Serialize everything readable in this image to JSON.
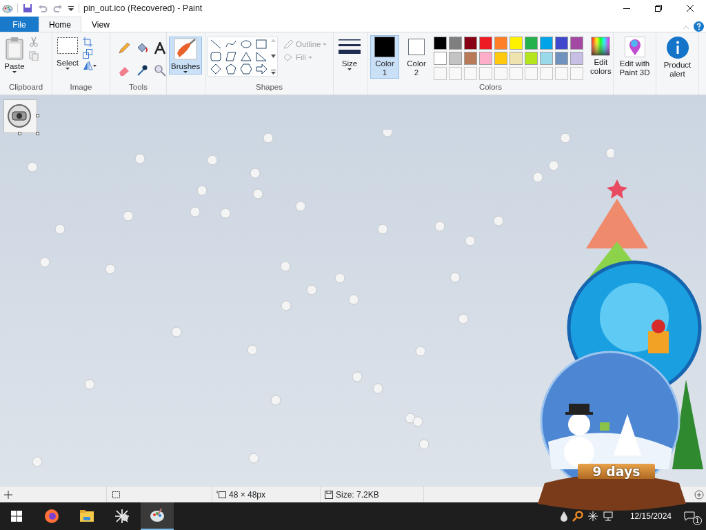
{
  "window": {
    "title": "pin_out.ico (Recovered) - Paint"
  },
  "tabs": [
    {
      "label": "File",
      "kind": "file",
      "selected": false
    },
    {
      "label": "Home",
      "kind": "tab",
      "selected": true
    },
    {
      "label": "View",
      "kind": "tab",
      "selected": false
    }
  ],
  "ribbon": {
    "clipboard": {
      "label": "Clipboard",
      "paste": "Paste"
    },
    "image": {
      "label": "Image",
      "select": "Select"
    },
    "tools": {
      "label": "Tools"
    },
    "brushes": {
      "label": "Brushes",
      "selected": true
    },
    "shapes": {
      "label": "Shapes",
      "outline": {
        "label": "Outline",
        "disabled": true
      },
      "fill": {
        "label": "Fill",
        "disabled": true
      }
    },
    "size": {
      "label": "Size"
    },
    "colors": {
      "label": "Colors",
      "color1": {
        "label": "Color 1",
        "color": "#000000",
        "selected": true
      },
      "color2": {
        "label": "Color 2",
        "color": "#ffffff",
        "selected": false
      },
      "palette": [
        [
          {
            "color": "#000000"
          },
          {
            "color": "#7f7f7f"
          },
          {
            "color": "#880015"
          },
          {
            "color": "#ed1c24"
          },
          {
            "color": "#ff7f27"
          },
          {
            "color": "#fff200"
          },
          {
            "color": "#22b14c"
          },
          {
            "color": "#00a2e8"
          },
          {
            "color": "#3f48cc"
          },
          {
            "color": "#a349a4"
          }
        ],
        [
          {
            "color": "#ffffff"
          },
          {
            "color": "#c3c3c3"
          },
          {
            "color": "#b97a57"
          },
          {
            "color": "#ffaec9"
          },
          {
            "color": "#ffc90e"
          },
          {
            "color": "#efe4b0"
          },
          {
            "color": "#b5e61d"
          },
          {
            "color": "#99d9ea"
          },
          {
            "color": "#7092be"
          },
          {
            "color": "#c8bfe7"
          }
        ],
        [
          {
            "kind": "empty"
          },
          {
            "kind": "empty"
          },
          {
            "kind": "empty"
          },
          {
            "kind": "empty"
          },
          {
            "kind": "empty"
          },
          {
            "kind": "empty"
          },
          {
            "kind": "empty"
          },
          {
            "kind": "empty"
          },
          {
            "kind": "empty"
          },
          {
            "kind": "empty"
          }
        ]
      ],
      "edit_colors": "Edit colors"
    },
    "paint3d": "Edit with Paint 3D",
    "product_alert": "Product alert"
  },
  "status_bar": {
    "dimensions": "48 × 48px",
    "size": "Size: 7.2KB"
  },
  "taskbar": {
    "apps": [
      {
        "kind": "firefox",
        "active": false
      },
      {
        "kind": "folder",
        "active": false
      },
      {
        "kind": "starburst",
        "active": false
      },
      {
        "kind": "paint",
        "active": true
      }
    ],
    "date": "12/15/2024",
    "notifications": "1"
  },
  "widget": {
    "countdown": "9 days"
  }
}
